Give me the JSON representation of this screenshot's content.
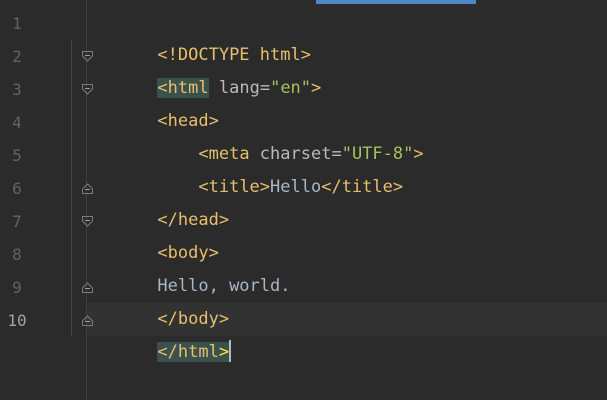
{
  "gutter": {
    "line_numbers": [
      "1",
      "2",
      "3",
      "4",
      "5",
      "6",
      "7",
      "8",
      "9",
      "10"
    ],
    "current_line": "10"
  },
  "code": {
    "line1": {
      "doctype": "<!DOCTYPE html>"
    },
    "line2": {
      "open": "<",
      "tag": "html",
      "space": " ",
      "attr": "lang",
      "eq": "=",
      "value": "\"en\"",
      "close": ">"
    },
    "line3": {
      "tag": "<head>"
    },
    "line4": {
      "indent": "    ",
      "open": "<meta ",
      "attr": "charset",
      "eq": "=",
      "value": "\"UTF-8\"",
      "close": ">"
    },
    "line5": {
      "indent": "    ",
      "open": "<title>",
      "text": "Hello",
      "close": "</title>"
    },
    "line6": {
      "tag": "</head>"
    },
    "line7": {
      "tag": "<body>"
    },
    "line8": {
      "text": "Hello, world."
    },
    "line9": {
      "tag": "</body>"
    },
    "line10": {
      "open": "</",
      "tag": "html",
      "close": ">"
    }
  },
  "colors": {
    "background": "#2b2b2b",
    "tag": "#e8bf6a",
    "attribute": "#bababa",
    "string": "#a5c25c",
    "text": "#a9b7c6",
    "match_highlight": "#3b514d",
    "scroll_indicator": "#4a88c7"
  }
}
